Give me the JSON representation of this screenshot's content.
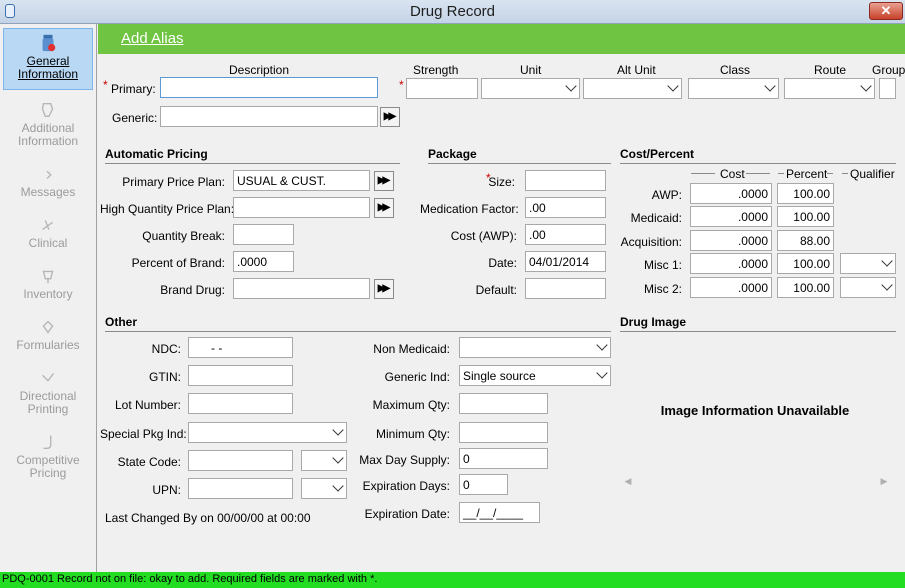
{
  "window": {
    "title": "Drug Record",
    "close_glyph": "✕"
  },
  "sidebar": {
    "items": [
      {
        "label1": "General",
        "label2": "Information",
        "icon": "pill-bottle-icon"
      },
      {
        "label1": "Additional",
        "label2": "Information",
        "icon": "info-icon"
      },
      {
        "label1": "Messages",
        "label2": "",
        "icon": "message-icon"
      },
      {
        "label1": "Clinical",
        "label2": "",
        "icon": "clinical-icon"
      },
      {
        "label1": "Inventory",
        "label2": "",
        "icon": "inventory-icon"
      },
      {
        "label1": "Formularies",
        "label2": "",
        "icon": "formulary-icon"
      },
      {
        "label1": "Directional",
        "label2": "Printing",
        "icon": "printing-icon"
      },
      {
        "label1": "Competitive",
        "label2": "Pricing",
        "icon": "pricing-icon"
      }
    ]
  },
  "header": {
    "add_alias": "Add Alias"
  },
  "description": {
    "col_description": "Description",
    "col_strength": "Strength",
    "col_unit": "Unit",
    "col_alt_unit": "Alt Unit",
    "col_class": "Class",
    "col_route": "Route",
    "col_group": "Group",
    "primary_label": "Primary:",
    "generic_label": "Generic:",
    "required_mark": "*",
    "primary_value": "",
    "generic_value": ""
  },
  "automatic_pricing": {
    "heading": "Automatic Pricing",
    "primary_price_plan_label": "Primary Price Plan:",
    "primary_price_plan_value": "USUAL & CUST.",
    "high_qty_label": "High Quantity Price Plan:",
    "high_qty_value": "",
    "qty_break_label": "Quantity Break:",
    "qty_break_value": "",
    "percent_brand_label": "Percent of Brand:",
    "percent_brand_value": ".0000",
    "brand_drug_label": "Brand Drug:",
    "brand_drug_value": ""
  },
  "package": {
    "heading": "Package",
    "size_label": "Size:",
    "size_value": "",
    "med_factor_label": "Medication Factor:",
    "med_factor_value": ".00",
    "cost_awp_label": "Cost (AWP):",
    "cost_awp_value": ".00",
    "date_label": "Date:",
    "date_value": "04/01/2014",
    "default_label": "Default:",
    "default_value": ""
  },
  "cost_percent": {
    "heading": "Cost/Percent",
    "col_cost": "Cost",
    "col_percent": "Percent",
    "col_qualifier": "Qualifier",
    "rows": [
      {
        "label": "AWP:",
        "cost": ".0000",
        "percent": "100.00"
      },
      {
        "label": "Medicaid:",
        "cost": ".0000",
        "percent": "100.00"
      },
      {
        "label": "Acquisition:",
        "cost": ".0000",
        "percent": "88.00"
      },
      {
        "label": "Misc 1:",
        "cost": ".0000",
        "percent": "100.00"
      },
      {
        "label": "Misc 2:",
        "cost": ".0000",
        "percent": "100.00"
      }
    ]
  },
  "other": {
    "heading": "Other",
    "ndc_label": "NDC:",
    "ndc_value": "-   -",
    "gtin_label": "GTIN:",
    "lot_label": "Lot Number:",
    "special_pkg_label": "Special Pkg Ind:",
    "state_code_label": "State Code:",
    "upn_label": "UPN:",
    "last_changed": "Last Changed By  on 00/00/00 at 00:00",
    "non_medicaid_label": "Non Medicaid:",
    "generic_ind_label": "Generic Ind:",
    "generic_ind_value": "Single source",
    "max_qty_label": "Maximum Qty:",
    "min_qty_label": "Minimum Qty:",
    "max_day_label": "Max Day Supply:",
    "max_day_value": "0",
    "exp_days_label": "Expiration Days:",
    "exp_days_value": "0",
    "exp_date_label": "Expiration Date:",
    "exp_date_value": "__/__/____"
  },
  "drug_image": {
    "heading": "Drug Image",
    "unavailable": "Image Information Unavailable"
  },
  "status": {
    "message": "PDQ-0001 Record not on file: okay to add.  Required fields are marked with *."
  }
}
